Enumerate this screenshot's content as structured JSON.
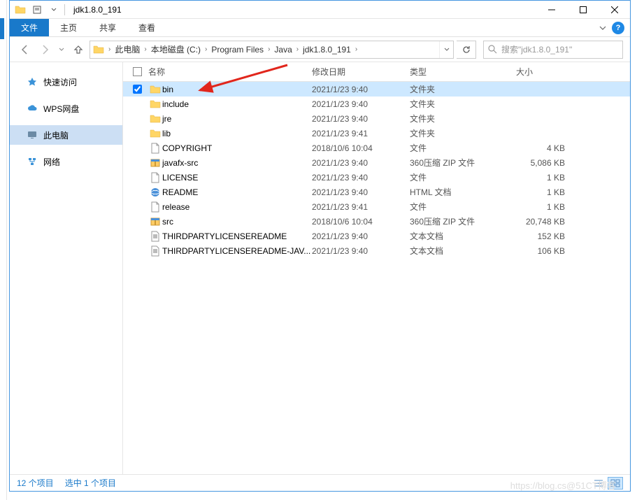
{
  "window": {
    "title": "jdk1.8.0_191"
  },
  "ribbon": {
    "file": "文件",
    "tabs": [
      "主页",
      "共享",
      "查看"
    ]
  },
  "breadcrumb": {
    "items": [
      "此电脑",
      "本地磁盘 (C:)",
      "Program Files",
      "Java",
      "jdk1.8.0_191"
    ]
  },
  "search": {
    "placeholder": "搜索\"jdk1.8.0_191\""
  },
  "sidebar": {
    "items": [
      {
        "icon": "star",
        "label": "快速访问",
        "color": "#3b93d8"
      },
      {
        "icon": "cloud",
        "label": "WPS网盘",
        "color": "#3b93d8"
      },
      {
        "icon": "monitor",
        "label": "此电脑",
        "color": "#6b8aa5",
        "selected": true
      },
      {
        "icon": "network",
        "label": "网络",
        "color": "#3b93d8"
      }
    ]
  },
  "columns": {
    "name": "名称",
    "date": "修改日期",
    "type": "类型",
    "size": "大小"
  },
  "files": [
    {
      "icon": "folder",
      "name": "bin",
      "date": "2021/1/23 9:40",
      "type": "文件夹",
      "size": "",
      "selected": true,
      "checked": true
    },
    {
      "icon": "folder",
      "name": "include",
      "date": "2021/1/23 9:40",
      "type": "文件夹",
      "size": ""
    },
    {
      "icon": "folder",
      "name": "jre",
      "date": "2021/1/23 9:40",
      "type": "文件夹",
      "size": ""
    },
    {
      "icon": "folder",
      "name": "lib",
      "date": "2021/1/23 9:41",
      "type": "文件夹",
      "size": ""
    },
    {
      "icon": "file",
      "name": "COPYRIGHT",
      "date": "2018/10/6 10:04",
      "type": "文件",
      "size": "4 KB"
    },
    {
      "icon": "zip",
      "name": "javafx-src",
      "date": "2021/1/23 9:40",
      "type": "360压缩 ZIP 文件",
      "size": "5,086 KB"
    },
    {
      "icon": "file",
      "name": "LICENSE",
      "date": "2021/1/23 9:40",
      "type": "文件",
      "size": "1 KB"
    },
    {
      "icon": "html",
      "name": "README",
      "date": "2021/1/23 9:40",
      "type": "HTML 文档",
      "size": "1 KB"
    },
    {
      "icon": "file",
      "name": "release",
      "date": "2021/1/23 9:41",
      "type": "文件",
      "size": "1 KB"
    },
    {
      "icon": "zip",
      "name": "src",
      "date": "2018/10/6 10:04",
      "type": "360压缩 ZIP 文件",
      "size": "20,748 KB"
    },
    {
      "icon": "text",
      "name": "THIRDPARTYLICENSEREADME",
      "date": "2021/1/23 9:40",
      "type": "文本文档",
      "size": "152 KB"
    },
    {
      "icon": "text",
      "name": "THIRDPARTYLICENSEREADME-JAV...",
      "date": "2021/1/23 9:40",
      "type": "文本文档",
      "size": "106 KB"
    }
  ],
  "status": {
    "items": "12 个项目",
    "selected": "选中 1 个项目"
  },
  "watermark": "https://blog.cs@51CT博客"
}
